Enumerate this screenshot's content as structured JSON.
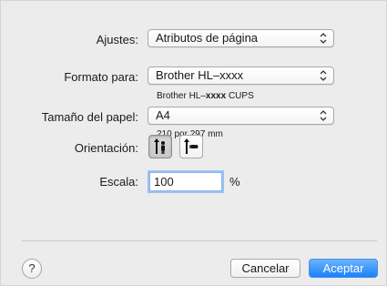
{
  "settings": {
    "label": "Ajustes:",
    "value": "Atributos de página"
  },
  "format_for": {
    "label": "Formato para:",
    "value": "Brother HL–xxxx",
    "detail_prefix": "Brother HL–",
    "detail_model": "xxxx",
    "detail_suffix": "CUPS"
  },
  "paper_size": {
    "label": "Tamaño del papel:",
    "value": "A4",
    "dimensions": "210 por 297 mm"
  },
  "orientation": {
    "label": "Orientación:",
    "options": [
      "portrait-icon",
      "landscape-icon"
    ],
    "selected": "portrait"
  },
  "scale": {
    "label": "Escala:",
    "value": "100",
    "unit": "%"
  },
  "footer": {
    "help": "?",
    "cancel": "Cancelar",
    "ok": "Aceptar"
  },
  "colors": {
    "default_button": "#1a82fb",
    "focus_ring": "#9cc1f2"
  }
}
